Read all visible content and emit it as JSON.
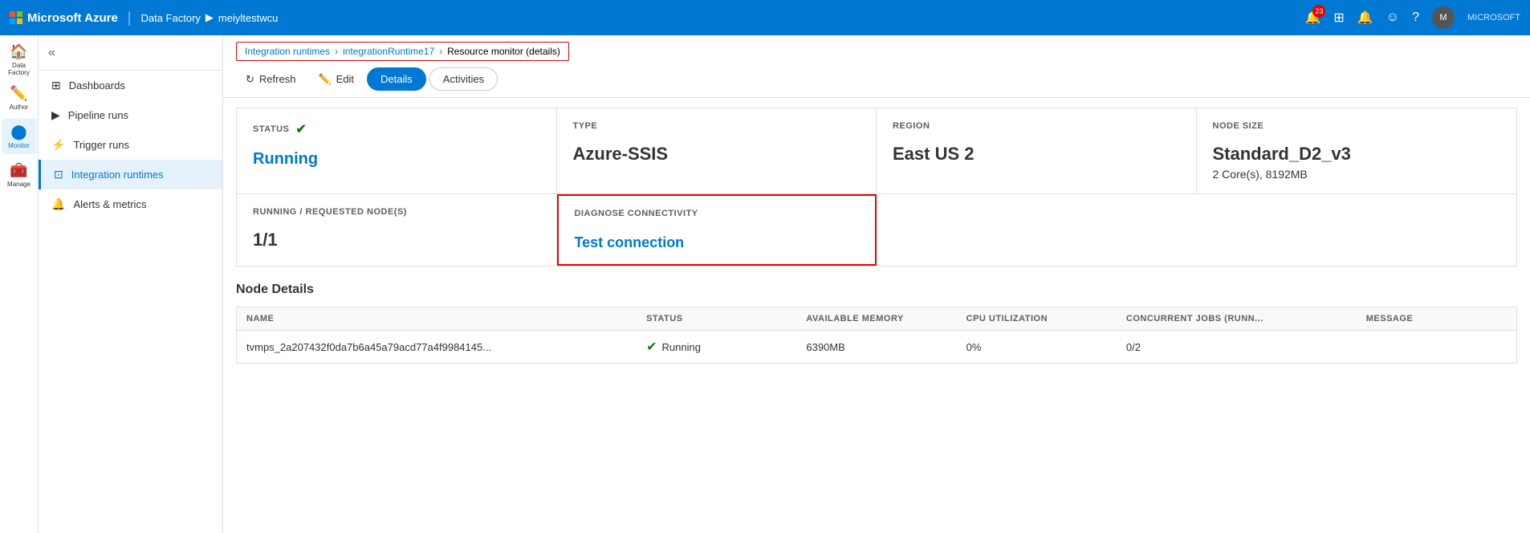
{
  "topNav": {
    "brand": "Microsoft Azure",
    "breadcrumb1": "Data Factory",
    "breadcrumb2": "meiyltestwcu",
    "notifications_count": "23",
    "microsoft_label": "MICROSOFT"
  },
  "leftNav": {
    "collapse_icon": "«",
    "items": [
      {
        "id": "data-factory",
        "label": "Data Factory",
        "icon": "🏠"
      },
      {
        "id": "author",
        "label": "Author",
        "icon": "✏️"
      },
      {
        "id": "monitor",
        "label": "Monitor",
        "icon": "🔵",
        "active": true
      },
      {
        "id": "manage",
        "label": "Manage",
        "icon": "🧰"
      }
    ]
  },
  "navPanel": {
    "items": [
      {
        "id": "dashboards",
        "label": "Dashboards",
        "icon": "⊞"
      },
      {
        "id": "pipeline-runs",
        "label": "Pipeline runs",
        "icon": "▶"
      },
      {
        "id": "trigger-runs",
        "label": "Trigger runs",
        "icon": "⚡"
      },
      {
        "id": "integration-runtimes",
        "label": "Integration runtimes",
        "icon": "⊡",
        "active": true
      },
      {
        "id": "alerts-metrics",
        "label": "Alerts & metrics",
        "icon": "🔔"
      }
    ]
  },
  "breadcrumb": {
    "items": [
      {
        "label": "Integration runtimes",
        "link": true
      },
      {
        "label": "integrationRuntime17",
        "link": true
      },
      {
        "label": "Resource monitor (details)",
        "link": false
      }
    ]
  },
  "toolbar": {
    "refresh_label": "Refresh",
    "edit_label": "Edit",
    "tab_details": "Details",
    "tab_activities": "Activities"
  },
  "cards": {
    "status": {
      "label": "STATUS",
      "value": "Running"
    },
    "type": {
      "label": "TYPE",
      "value": "Azure-SSIS"
    },
    "region": {
      "label": "REGION",
      "value": "East US 2"
    },
    "node_size": {
      "label": "NODE SIZE",
      "value": "Standard_D2_v3",
      "sub": "2 Core(s), 8192MB"
    }
  },
  "cards2": {
    "nodes": {
      "label": "RUNNING / REQUESTED NODE(S)",
      "value": "1/1"
    },
    "diagnose": {
      "label": "DIAGNOSE CONNECTIVITY",
      "value": "Test connection"
    }
  },
  "nodeDetails": {
    "title": "Node Details",
    "columns": [
      "NAME",
      "STATUS",
      "AVAILABLE MEMORY",
      "CPU UTILIZATION",
      "CONCURRENT JOBS (RUNN...",
      "MESSAGE"
    ],
    "rows": [
      {
        "name": "tvmps_2a207432f0da7b6a45a79acd77a4f9984145...",
        "status": "Running",
        "available_memory": "6390MB",
        "cpu_utilization": "0%",
        "concurrent_jobs": "0/2",
        "message": ""
      }
    ]
  }
}
